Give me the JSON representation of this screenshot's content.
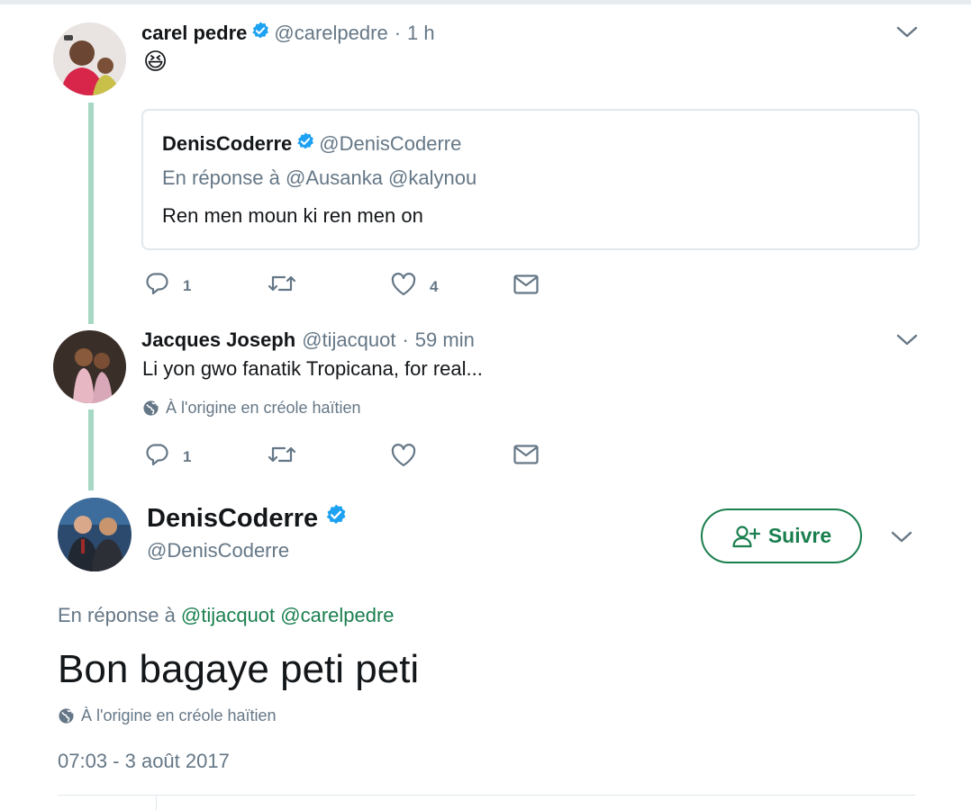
{
  "thread": [
    {
      "name": "carel pedre",
      "handle": "@carelpedre",
      "sep": "·",
      "time": "1 h",
      "text": "😆",
      "quoted": {
        "name": "DenisCoderre",
        "handle": "@DenisCoderre",
        "reply_to": "En réponse à @Ausanka @kalynou",
        "text": "Ren men moun ki ren men on"
      },
      "actions": {
        "replies": "1",
        "retweets": "",
        "likes": "4"
      }
    },
    {
      "name": "Jacques Joseph",
      "handle": "@tijacquot",
      "sep": "·",
      "time": "59 min",
      "text": "Li yon gwo fanatik Tropicana, for real...",
      "lang_note": "À l'origine en créole haïtien",
      "actions": {
        "replies": "1",
        "retweets": "",
        "likes": ""
      }
    }
  ],
  "main_tweet": {
    "name": "DenisCoderre",
    "handle": "@DenisCoderre",
    "follow_label": "Suivre",
    "reply_prefix": "En réponse à",
    "reply_mentions": "@tijacquot @carelpedre",
    "text": "Bon bagaye peti peti",
    "lang_note": "À l'origine en créole haïtien",
    "timestamp": "07:03 - 3 août 2017"
  },
  "colors": {
    "verified": "#1da1f2",
    "accent_green": "#1a7f4e",
    "thread_line": "#a6d8c4",
    "muted": "#657786"
  }
}
